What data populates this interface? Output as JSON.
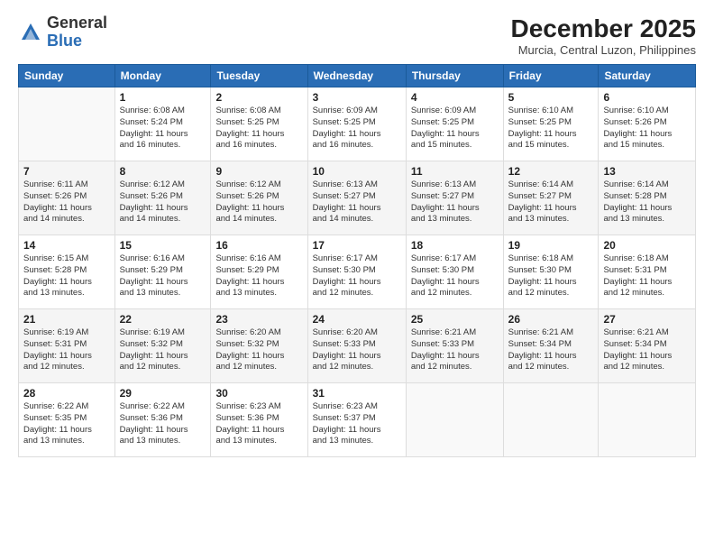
{
  "header": {
    "logo_general": "General",
    "logo_blue": "Blue",
    "month_year": "December 2025",
    "location": "Murcia, Central Luzon, Philippines"
  },
  "weekdays": [
    "Sunday",
    "Monday",
    "Tuesday",
    "Wednesday",
    "Thursday",
    "Friday",
    "Saturday"
  ],
  "weeks": [
    [
      {
        "day": "",
        "sunrise": "",
        "sunset": "",
        "daylight": ""
      },
      {
        "day": "1",
        "sunrise": "Sunrise: 6:08 AM",
        "sunset": "Sunset: 5:24 PM",
        "daylight": "Daylight: 11 hours and 16 minutes."
      },
      {
        "day": "2",
        "sunrise": "Sunrise: 6:08 AM",
        "sunset": "Sunset: 5:25 PM",
        "daylight": "Daylight: 11 hours and 16 minutes."
      },
      {
        "day": "3",
        "sunrise": "Sunrise: 6:09 AM",
        "sunset": "Sunset: 5:25 PM",
        "daylight": "Daylight: 11 hours and 16 minutes."
      },
      {
        "day": "4",
        "sunrise": "Sunrise: 6:09 AM",
        "sunset": "Sunset: 5:25 PM",
        "daylight": "Daylight: 11 hours and 15 minutes."
      },
      {
        "day": "5",
        "sunrise": "Sunrise: 6:10 AM",
        "sunset": "Sunset: 5:25 PM",
        "daylight": "Daylight: 11 hours and 15 minutes."
      },
      {
        "day": "6",
        "sunrise": "Sunrise: 6:10 AM",
        "sunset": "Sunset: 5:26 PM",
        "daylight": "Daylight: 11 hours and 15 minutes."
      }
    ],
    [
      {
        "day": "7",
        "sunrise": "Sunrise: 6:11 AM",
        "sunset": "Sunset: 5:26 PM",
        "daylight": "Daylight: 11 hours and 14 minutes."
      },
      {
        "day": "8",
        "sunrise": "Sunrise: 6:12 AM",
        "sunset": "Sunset: 5:26 PM",
        "daylight": "Daylight: 11 hours and 14 minutes."
      },
      {
        "day": "9",
        "sunrise": "Sunrise: 6:12 AM",
        "sunset": "Sunset: 5:26 PM",
        "daylight": "Daylight: 11 hours and 14 minutes."
      },
      {
        "day": "10",
        "sunrise": "Sunrise: 6:13 AM",
        "sunset": "Sunset: 5:27 PM",
        "daylight": "Daylight: 11 hours and 14 minutes."
      },
      {
        "day": "11",
        "sunrise": "Sunrise: 6:13 AM",
        "sunset": "Sunset: 5:27 PM",
        "daylight": "Daylight: 11 hours and 13 minutes."
      },
      {
        "day": "12",
        "sunrise": "Sunrise: 6:14 AM",
        "sunset": "Sunset: 5:27 PM",
        "daylight": "Daylight: 11 hours and 13 minutes."
      },
      {
        "day": "13",
        "sunrise": "Sunrise: 6:14 AM",
        "sunset": "Sunset: 5:28 PM",
        "daylight": "Daylight: 11 hours and 13 minutes."
      }
    ],
    [
      {
        "day": "14",
        "sunrise": "Sunrise: 6:15 AM",
        "sunset": "Sunset: 5:28 PM",
        "daylight": "Daylight: 11 hours and 13 minutes."
      },
      {
        "day": "15",
        "sunrise": "Sunrise: 6:16 AM",
        "sunset": "Sunset: 5:29 PM",
        "daylight": "Daylight: 11 hours and 13 minutes."
      },
      {
        "day": "16",
        "sunrise": "Sunrise: 6:16 AM",
        "sunset": "Sunset: 5:29 PM",
        "daylight": "Daylight: 11 hours and 13 minutes."
      },
      {
        "day": "17",
        "sunrise": "Sunrise: 6:17 AM",
        "sunset": "Sunset: 5:30 PM",
        "daylight": "Daylight: 11 hours and 12 minutes."
      },
      {
        "day": "18",
        "sunrise": "Sunrise: 6:17 AM",
        "sunset": "Sunset: 5:30 PM",
        "daylight": "Daylight: 11 hours and 12 minutes."
      },
      {
        "day": "19",
        "sunrise": "Sunrise: 6:18 AM",
        "sunset": "Sunset: 5:30 PM",
        "daylight": "Daylight: 11 hours and 12 minutes."
      },
      {
        "day": "20",
        "sunrise": "Sunrise: 6:18 AM",
        "sunset": "Sunset: 5:31 PM",
        "daylight": "Daylight: 11 hours and 12 minutes."
      }
    ],
    [
      {
        "day": "21",
        "sunrise": "Sunrise: 6:19 AM",
        "sunset": "Sunset: 5:31 PM",
        "daylight": "Daylight: 11 hours and 12 minutes."
      },
      {
        "day": "22",
        "sunrise": "Sunrise: 6:19 AM",
        "sunset": "Sunset: 5:32 PM",
        "daylight": "Daylight: 11 hours and 12 minutes."
      },
      {
        "day": "23",
        "sunrise": "Sunrise: 6:20 AM",
        "sunset": "Sunset: 5:32 PM",
        "daylight": "Daylight: 11 hours and 12 minutes."
      },
      {
        "day": "24",
        "sunrise": "Sunrise: 6:20 AM",
        "sunset": "Sunset: 5:33 PM",
        "daylight": "Daylight: 11 hours and 12 minutes."
      },
      {
        "day": "25",
        "sunrise": "Sunrise: 6:21 AM",
        "sunset": "Sunset: 5:33 PM",
        "daylight": "Daylight: 11 hours and 12 minutes."
      },
      {
        "day": "26",
        "sunrise": "Sunrise: 6:21 AM",
        "sunset": "Sunset: 5:34 PM",
        "daylight": "Daylight: 11 hours and 12 minutes."
      },
      {
        "day": "27",
        "sunrise": "Sunrise: 6:21 AM",
        "sunset": "Sunset: 5:34 PM",
        "daylight": "Daylight: 11 hours and 12 minutes."
      }
    ],
    [
      {
        "day": "28",
        "sunrise": "Sunrise: 6:22 AM",
        "sunset": "Sunset: 5:35 PM",
        "daylight": "Daylight: 11 hours and 13 minutes."
      },
      {
        "day": "29",
        "sunrise": "Sunrise: 6:22 AM",
        "sunset": "Sunset: 5:36 PM",
        "daylight": "Daylight: 11 hours and 13 minutes."
      },
      {
        "day": "30",
        "sunrise": "Sunrise: 6:23 AM",
        "sunset": "Sunset: 5:36 PM",
        "daylight": "Daylight: 11 hours and 13 minutes."
      },
      {
        "day": "31",
        "sunrise": "Sunrise: 6:23 AM",
        "sunset": "Sunset: 5:37 PM",
        "daylight": "Daylight: 11 hours and 13 minutes."
      },
      {
        "day": "",
        "sunrise": "",
        "sunset": "",
        "daylight": ""
      },
      {
        "day": "",
        "sunrise": "",
        "sunset": "",
        "daylight": ""
      },
      {
        "day": "",
        "sunrise": "",
        "sunset": "",
        "daylight": ""
      }
    ]
  ]
}
